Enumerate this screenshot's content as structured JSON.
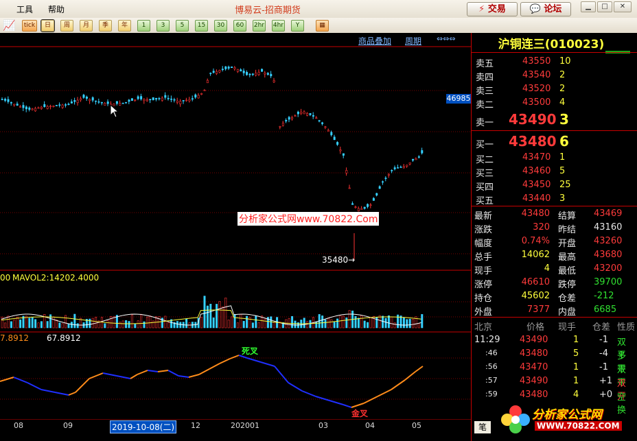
{
  "titlebar": {
    "menu": [
      "工具",
      "帮助"
    ],
    "title": "博易云-招商期货",
    "trade_btn": "交易",
    "forum_btn": "论坛"
  },
  "toolbar": {
    "buttons": [
      "tick",
      "日",
      "周",
      "月",
      "季",
      "年",
      "1",
      "3",
      "5",
      "15",
      "30",
      "60",
      "2hr",
      "4hr",
      "Y"
    ]
  },
  "chart": {
    "links": [
      "商品叠加",
      "周期"
    ],
    "price_label": "46985",
    "low_label": "35480→",
    "watermark": "分析家公式网www.70822.Com",
    "vol_label_left": "00",
    "vol_label": "MAVOL2:14202.4000",
    "ind_label_a": "7.8912",
    "ind_label_b": "67.8912",
    "death_cross": "死叉",
    "golden_cross": "金叉",
    "x_ticks": [
      "08",
      "09",
      "2019-10-08(二)",
      "12",
      "202001",
      "03",
      "04",
      "05"
    ],
    "colors": {
      "up": "#ff3333",
      "down": "#35d0ff",
      "line_orange": "#ff8c1a",
      "line_blue": "#1f2fff"
    }
  },
  "chart_data": {
    "type": "candlestick",
    "low_marker": 35480,
    "current_marker": 46985,
    "series": [
      {
        "name": "MAVOL2",
        "last": 14202.4
      }
    ]
  },
  "quote": {
    "title": "沪铜连三(010023)",
    "asks": [
      {
        "label": "卖五",
        "price": "43550",
        "vol": "10"
      },
      {
        "label": "卖四",
        "price": "43540",
        "vol": "2"
      },
      {
        "label": "卖三",
        "price": "43520",
        "vol": "2"
      },
      {
        "label": "卖二",
        "price": "43500",
        "vol": "4"
      },
      {
        "label": "卖一",
        "price": "43490",
        "vol": "3"
      }
    ],
    "bids": [
      {
        "label": "买一",
        "price": "43480",
        "vol": "6"
      },
      {
        "label": "买二",
        "price": "43470",
        "vol": "1"
      },
      {
        "label": "买三",
        "price": "43460",
        "vol": "5"
      },
      {
        "label": "买四",
        "price": "43450",
        "vol": "25"
      },
      {
        "label": "买五",
        "price": "43440",
        "vol": "3"
      }
    ],
    "stats": [
      {
        "l1": "最新",
        "v1": "43480",
        "l2": "结算",
        "v2": "43469"
      },
      {
        "l1": "涨跌",
        "v1": "320",
        "l2": "昨结",
        "v2": "43160"
      },
      {
        "l1": "幅度",
        "v1": "0.74%",
        "l2": "开盘",
        "v2": "43260"
      },
      {
        "l1": "总手",
        "v1": "14062",
        "l2": "最高",
        "v2": "43680"
      },
      {
        "l1": "现手",
        "v1": "4",
        "l2": "最低",
        "v2": "43200"
      },
      {
        "l1": "涨停",
        "v1": "46610",
        "l2": "跌停",
        "v2": "39700"
      },
      {
        "l1": "持仓",
        "v1": "45602",
        "l2": "仓差",
        "v2": "-212"
      },
      {
        "l1": "外盘",
        "v1": "7377",
        "l2": "内盘",
        "v2": "6685"
      }
    ],
    "tick_header": [
      "北京",
      "价格",
      "现手",
      "仓差",
      "性质"
    ],
    "ticks": [
      {
        "time": "11:29",
        "price": "43490",
        "vol": "1",
        "diff": "-1",
        "nature": "双平"
      },
      {
        "time": ":46",
        "price": "43480",
        "vol": "5",
        "diff": "-4",
        "nature": "多平"
      },
      {
        "time": ":56",
        "price": "43470",
        "vol": "1",
        "diff": "-1",
        "nature": "双平"
      },
      {
        "time": ":57",
        "price": "43490",
        "vol": "1",
        "diff": "+1",
        "nature": "双开"
      },
      {
        "time": ":59",
        "price": "43480",
        "vol": "4",
        "diff": "+0",
        "nature": "空换"
      }
    ],
    "bottom_tab": "笔"
  },
  "logo": {
    "text": "分析家公式网",
    "url": "WWW.70822.COM"
  }
}
